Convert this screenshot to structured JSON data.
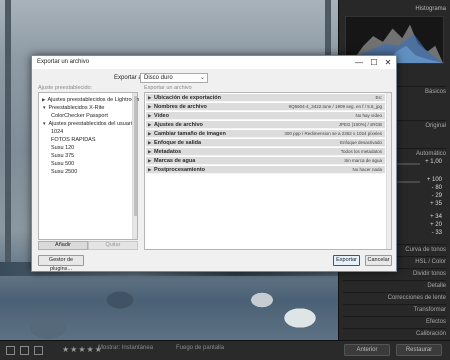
{
  "dialog": {
    "title": "Exportar un archivo",
    "export_to_label": "Exportar a:",
    "export_to_value": "Disco duro",
    "presets_header": "Ajuste preestablecido:",
    "sections_header": "Exportar un archivo",
    "presets": [
      {
        "label": "Ajustes preestablecidos de Lightroom",
        "expanded": false
      },
      {
        "label": "Preestablecidos X-Rite",
        "expanded": true
      },
      {
        "label": "ColorChecker Passport",
        "expanded": null
      },
      {
        "label": "Ajustes preestablecidos del usuario",
        "expanded": true
      },
      {
        "label": "1024",
        "expanded": null
      },
      {
        "label": "FOTOS RAPIDAS",
        "expanded": null
      },
      {
        "label": "Susu 120",
        "expanded": null
      },
      {
        "label": "Susu 375",
        "expanded": null
      },
      {
        "label": "Susu 500",
        "expanded": null
      },
      {
        "label": "Susu 2500",
        "expanded": null
      }
    ],
    "add_label": "Añadir",
    "remove_label": "Quitar",
    "sections": [
      {
        "name": "Ubicación de exportación",
        "value": "Es:"
      },
      {
        "name": "Nombres de archivo",
        "value": "9Q5604-4_3422.tone / 1909 seg. en f / 5.6_jpg"
      },
      {
        "name": "Vídeo",
        "value": "No hay vídeo"
      },
      {
        "name": "Ajustes de archivo",
        "value": "JPEG (100%) / sRGB"
      },
      {
        "name": "Cambiar tamaño de imagen",
        "value": "300 ppp / Redimension se a 2362 x 1024 píxeles"
      },
      {
        "name": "Enfoque de salida",
        "value": "Enfoque desactivado"
      },
      {
        "name": "Metadatos",
        "value": "Todos los metadatos"
      },
      {
        "name": "Marcas de agua",
        "value": "Sin marca de agua"
      },
      {
        "name": "Postprocesamiento",
        "value": "No hacer nada"
      }
    ],
    "plugin_manager_label": "Gestor de plugins...",
    "export_label": "Exportar",
    "cancel_label": "Cancelar",
    "window_minimize": "—",
    "window_maximize": "☐",
    "window_close": "✕"
  },
  "lightroom": {
    "histogram_label": "Histograma",
    "panel_values": [
      "+ 1,00",
      "+ 100",
      "- 80",
      "- 29",
      "+ 35",
      "+ 34",
      "+ 20",
      "- 33"
    ],
    "panel_labels": [
      "Básicos",
      "Original",
      "Automático"
    ],
    "panel_sections": [
      "Curva de tonos",
      "HSL / Color",
      "Dividir tonos",
      "Detalle",
      "Correcciones de lente",
      "Transformar",
      "Efectos",
      "Calibración"
    ],
    "filmstrip": {
      "mode_label": "Mostrar: Instantánea",
      "sort_label": "Fuego de pantalla",
      "previous_label": "Anterior",
      "reset_label": "Restaurar",
      "stars": "★★★★★"
    },
    "accent_color": "#0a64c8"
  }
}
